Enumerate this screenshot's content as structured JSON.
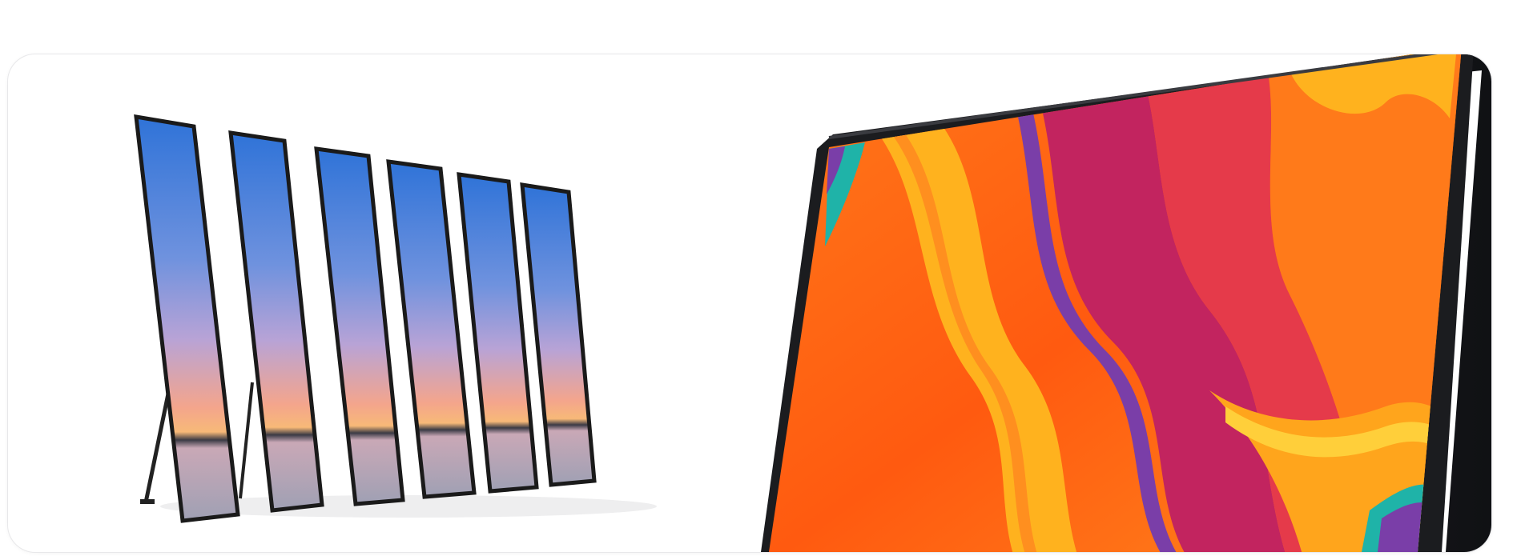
{
  "scene": {
    "left_product": "poster-led-screens",
    "left_panel_count": 6,
    "right_product": "large-display-monitor",
    "colors": {
      "card_border": "#e8e8ea",
      "sky_top": "#2f73d8",
      "sky_mid": "#a9a6d9",
      "sky_glow": "#f6b07a",
      "sea": "#a8a6b6",
      "frame_dark": "#1e1f22",
      "wave_orange": "#ff6a12",
      "wave_yellow": "#ffb21e",
      "wave_magenta": "#c2245f",
      "wave_purple": "#7a3ea8",
      "wave_teal": "#1fb3a8"
    }
  }
}
